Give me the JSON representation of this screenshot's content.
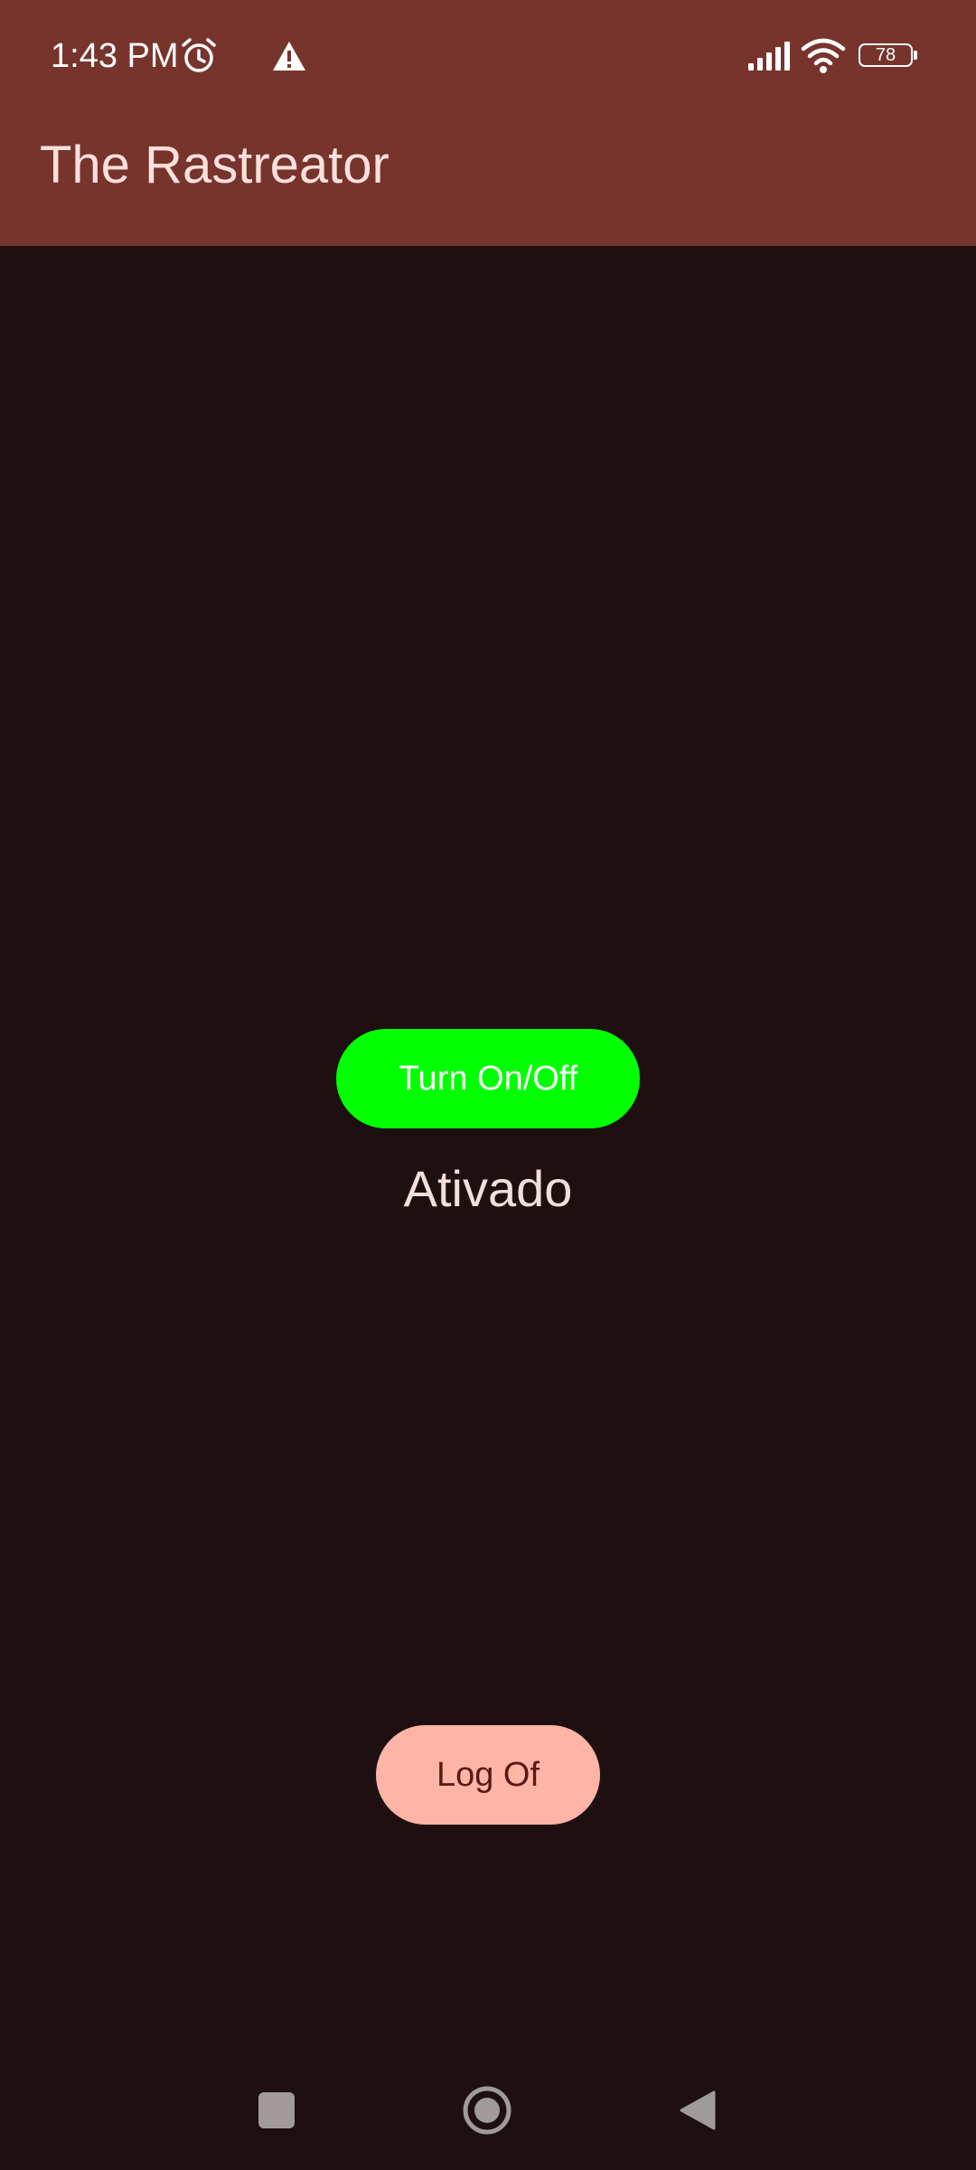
{
  "status_bar": {
    "time": "1:43 PM",
    "battery_level": "78",
    "icons": [
      "alarm-icon",
      "warning-icon",
      "signal-icon",
      "wifi-icon",
      "battery-icon"
    ]
  },
  "app_bar": {
    "title": "The Rastreator"
  },
  "main": {
    "toggle_button_label": "Turn On/Off",
    "status_text": "Ativado",
    "logoff_button_label": "Log Of"
  },
  "nav_bar": {
    "icons": [
      "recents-icon",
      "home-icon",
      "back-icon"
    ]
  },
  "colors": {
    "app_bar": "#77342d",
    "background": "#1e1010",
    "toggle_button": "#00ff00",
    "logoff_button": "#ffb4a8"
  }
}
